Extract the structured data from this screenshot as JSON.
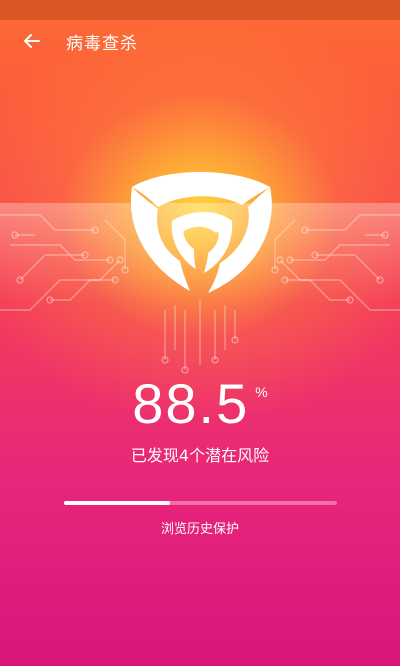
{
  "app_bar": {
    "title": "病毒查杀",
    "back_icon": "arrow-left-icon"
  },
  "scan": {
    "percent": "88.5",
    "percent_unit": "%",
    "progress_fraction": 0.39,
    "risk_message": "已发现4个潜在风险",
    "current_item": "浏览历史保护"
  },
  "colors": {
    "status_bar": "#dc5526",
    "top": "#fd6a33",
    "middle": "#f43c5a",
    "bottom": "#d9157c",
    "glow": "#ffe13c",
    "text": "#ffffff"
  }
}
